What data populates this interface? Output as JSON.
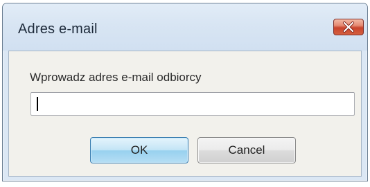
{
  "window": {
    "title": "Adres e-mail"
  },
  "dialog": {
    "prompt": "Wprowadz adres e-mail odbiorcy",
    "email_value": "",
    "ok_label": "OK",
    "cancel_label": "Cancel"
  },
  "icons": {
    "close": "close-icon"
  },
  "colors": {
    "titlebar": "#dbe7f4",
    "client_background": "#f2f1ec",
    "close_button": "#c9432c",
    "ok_button_focus": "#3c7fb1"
  }
}
